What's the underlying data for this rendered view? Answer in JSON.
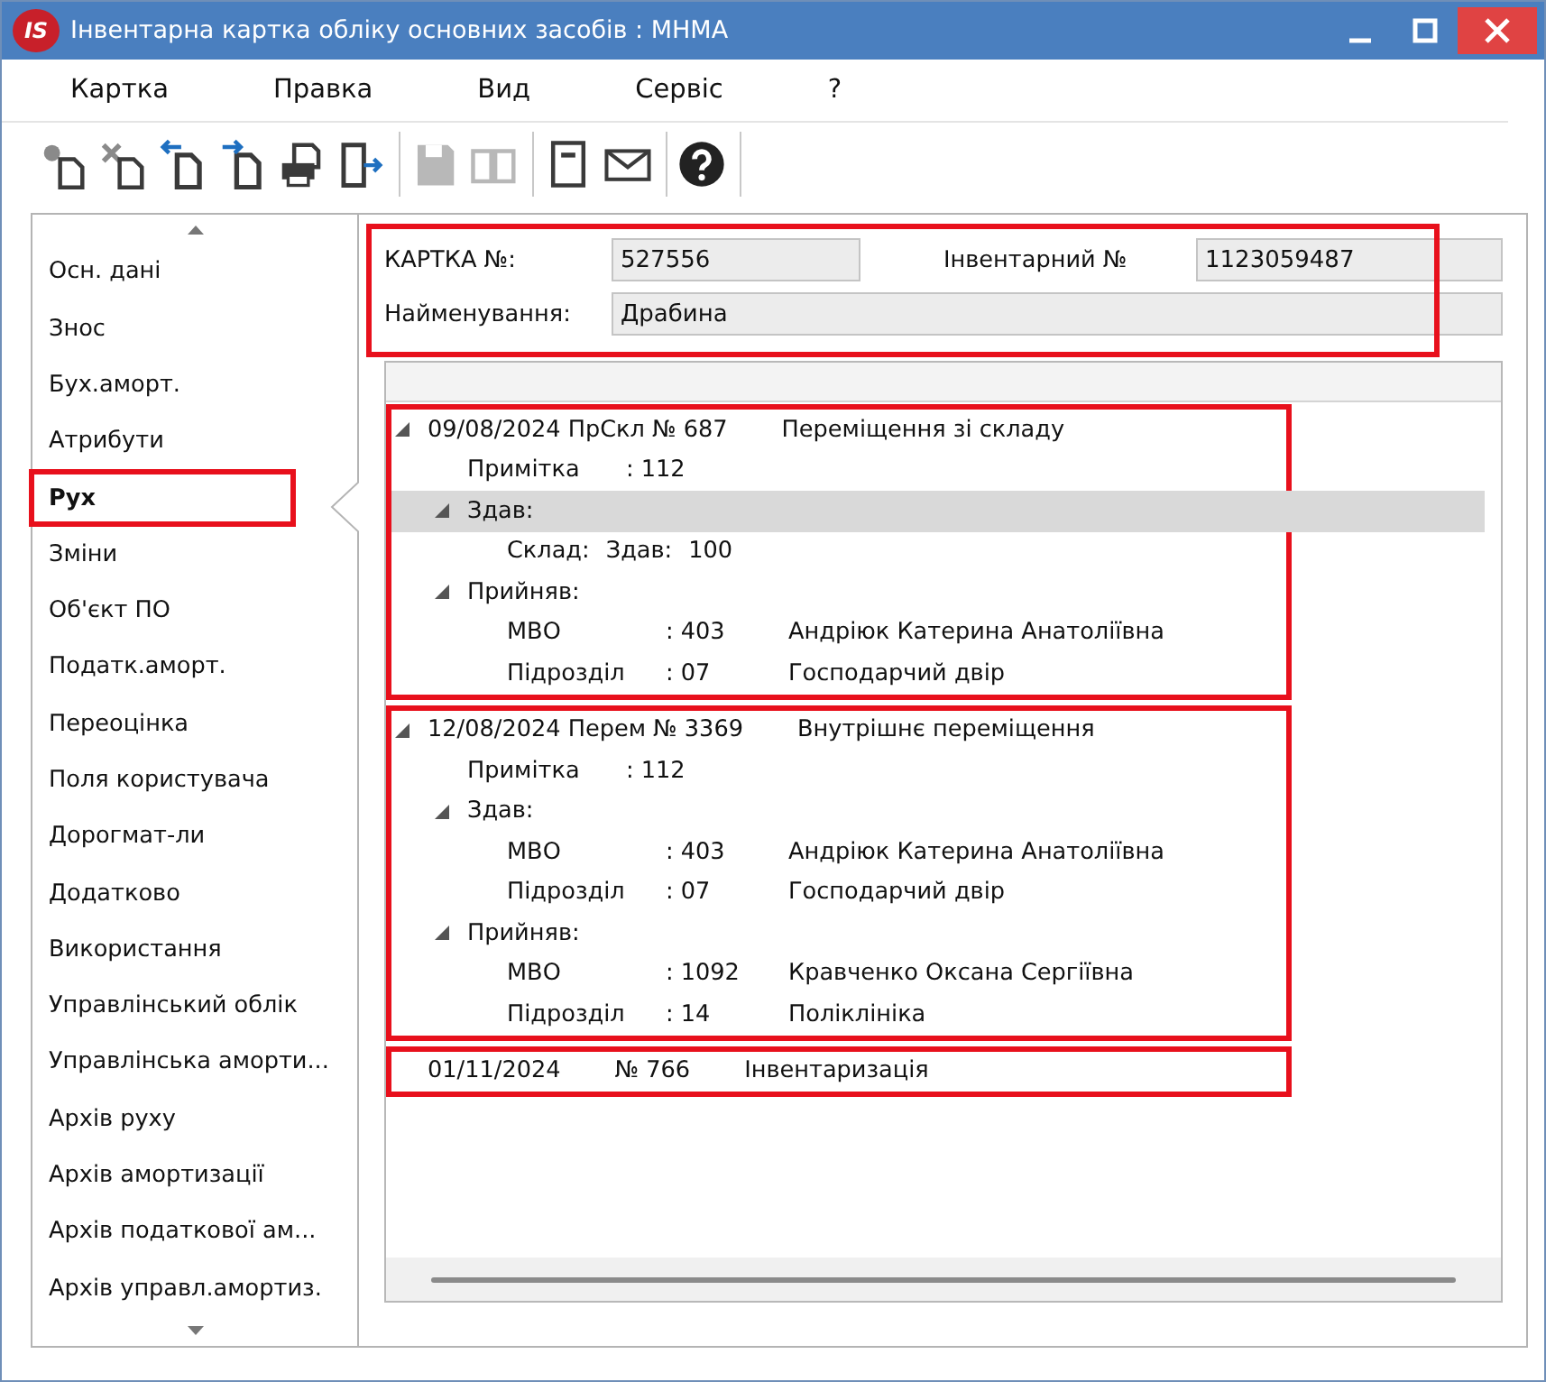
{
  "window": {
    "logo": "IS",
    "title": "Інвентарна картка обліку основних засобів  : МНМА"
  },
  "menu": [
    "Картка",
    "Правка",
    "Вид",
    "Сервіс",
    "?"
  ],
  "toolbar": [
    {
      "kind": "new",
      "disabled": false
    },
    {
      "kind": "delete",
      "disabled": false
    },
    {
      "kind": "prev",
      "disabled": false
    },
    {
      "kind": "next",
      "disabled": false
    },
    {
      "kind": "print",
      "disabled": false
    },
    {
      "kind": "exit",
      "disabled": false
    },
    {
      "kind": "save",
      "disabled": true
    },
    {
      "kind": "book",
      "disabled": true
    },
    {
      "kind": "note",
      "disabled": false
    },
    {
      "kind": "mail",
      "disabled": false
    },
    {
      "kind": "help",
      "disabled": false
    }
  ],
  "sidebar": {
    "items": [
      {
        "label": "Осн. дані",
        "selected": false,
        "highlighted": false
      },
      {
        "label": "Знос",
        "selected": false,
        "highlighted": false
      },
      {
        "label": "Бух.аморт.",
        "selected": false,
        "highlighted": false
      },
      {
        "label": "Атрибути",
        "selected": false,
        "highlighted": false
      },
      {
        "label": "Рух",
        "selected": true,
        "highlighted": true
      },
      {
        "label": "Зміни",
        "selected": false,
        "highlighted": false
      },
      {
        "label": "Об'єкт ПО",
        "selected": false,
        "highlighted": false
      },
      {
        "label": "Податк.аморт.",
        "selected": false,
        "highlighted": false
      },
      {
        "label": "Переоцінка",
        "selected": false,
        "highlighted": false
      },
      {
        "label": "Поля користувача",
        "selected": false,
        "highlighted": false
      },
      {
        "label": "Дорогмат-ли",
        "selected": false,
        "highlighted": false
      },
      {
        "label": "Додатково",
        "selected": false,
        "highlighted": false
      },
      {
        "label": "Використання",
        "selected": false,
        "highlighted": false
      },
      {
        "label": "Управлінський облік",
        "selected": false,
        "highlighted": false
      },
      {
        "label": "Управлінська аморти...",
        "selected": false,
        "highlighted": false
      },
      {
        "label": "Архів руху",
        "selected": false,
        "highlighted": false
      },
      {
        "label": "Архів амортизації",
        "selected": false,
        "highlighted": false
      },
      {
        "label": "Архів податкової ам...",
        "selected": false,
        "highlighted": false
      },
      {
        "label": "Архів управл.амортиз.",
        "selected": false,
        "highlighted": false
      }
    ]
  },
  "header": {
    "highlighted": true,
    "card_label": "КАРТКА №:",
    "card_value": "527556",
    "inv_label": "Інвентарний №",
    "inv_value": "1123059487",
    "name_label": "Найменування:",
    "name_value": "Драбина"
  },
  "tree": [
    {
      "kind": "document",
      "parts": [
        "09/08/2024 ПрСкл № 687",
        "Переміщення зі складу"
      ],
      "expanded": true,
      "selected": false,
      "highlighted": true,
      "children": [
        {
          "kind": "field",
          "parts": [
            "Примітка",
            ": 112"
          ],
          "selected": false
        },
        {
          "kind": "group",
          "parts": [
            "Здав:"
          ],
          "expanded": true,
          "selected": true,
          "children": [
            {
              "kind": "stock",
              "parts": [
                "Склад:",
                "Здав:",
                "100"
              ],
              "selected": false
            }
          ]
        },
        {
          "kind": "group",
          "parts": [
            "Прийняв:"
          ],
          "expanded": true,
          "selected": false,
          "children": [
            {
              "kind": "field",
              "parts": [
                "МВО",
                ": 403",
                "Андріюк Катерина Анатоліївна"
              ],
              "selected": false
            },
            {
              "kind": "field",
              "parts": [
                "Підрозділ",
                ": 07",
                "Господарчий двір"
              ],
              "selected": false
            }
          ]
        }
      ]
    },
    {
      "kind": "document",
      "parts": [
        "12/08/2024 Перем № 3369",
        "Внутрішнє переміщення"
      ],
      "expanded": true,
      "selected": false,
      "highlighted": true,
      "children": [
        {
          "kind": "field",
          "parts": [
            "Примітка",
            ": 112"
          ],
          "selected": false
        },
        {
          "kind": "group",
          "parts": [
            "Здав:"
          ],
          "expanded": true,
          "selected": false,
          "children": [
            {
              "kind": "field",
              "parts": [
                "МВО",
                ": 403",
                "Андріюк Катерина Анатоліївна"
              ],
              "selected": false
            },
            {
              "kind": "field",
              "parts": [
                "Підрозділ",
                ": 07",
                "Господарчий двір"
              ],
              "selected": false
            }
          ]
        },
        {
          "kind": "group",
          "parts": [
            "Прийняв:"
          ],
          "expanded": true,
          "selected": false,
          "children": [
            {
              "kind": "field",
              "parts": [
                "МВО",
                ": 1092",
                "Кравченко Оксана Сергіївна"
              ],
              "selected": false
            },
            {
              "kind": "field",
              "parts": [
                "Підрозділ",
                ": 14",
                "Поліклініка"
              ],
              "selected": false
            }
          ]
        }
      ]
    },
    {
      "kind": "document",
      "parts": [
        "01/11/2024",
        "№ 766",
        "Інвентаризація"
      ],
      "selected": false,
      "highlighted": true
    }
  ]
}
